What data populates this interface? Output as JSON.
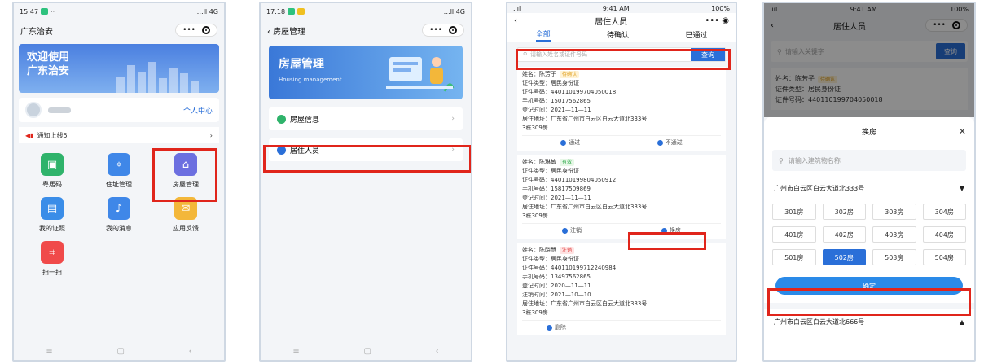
{
  "p1": {
    "time": "15:47",
    "dots": "··",
    "signal": ":::ll 4G",
    "title": "广东治安",
    "banner": [
      "欢迎使用",
      "广东治安"
    ],
    "user_link": "个人中心",
    "notice": "通知上线5",
    "grid": [
      {
        "label": "粤居码",
        "icon": "qr-card-icon",
        "color": "#2fb36b"
      },
      {
        "label": "住址管理",
        "icon": "location-icon",
        "color": "#3f87e8"
      },
      {
        "label": "房屋管理",
        "icon": "house-icon",
        "color": "#6c6fe0"
      },
      {
        "label": "我的证照",
        "icon": "id-card-icon",
        "color": "#3a8de8"
      },
      {
        "label": "我的消息",
        "icon": "bell-icon",
        "color": "#3f87e8"
      },
      {
        "label": "应用反馈",
        "icon": "mail-icon",
        "color": "#f3b73a"
      },
      {
        "label": "扫一扫",
        "icon": "scan-icon",
        "color": "#f04a4a"
      }
    ]
  },
  "p2": {
    "time": "17:18",
    "signal": ":::ll 4G",
    "title": "房屋管理",
    "banner_title": "房屋管理",
    "banner_sub": "Housing management",
    "menu": [
      {
        "label": "房屋信息",
        "color": "#2fb36b"
      },
      {
        "label": "居住人员",
        "color": "#2a6fd8"
      }
    ]
  },
  "p3": {
    "time": "9:41 AM",
    "battery": "100%",
    "title": "居住人员",
    "tabs": [
      "全部",
      "待确认",
      "已通过"
    ],
    "search_placeholder": "请输入姓名或证件号码",
    "search_btn": "查询",
    "cards": [
      {
        "name": "姓名：陈芳子",
        "tag": "待确认",
        "tagc": "y",
        "lines": [
          "证件类型：居民身份证",
          "证件号码：440110199704050018",
          "手机号码：15017562865",
          "登记时间：2021—11—11",
          "居住地址：广东省广州市白云区白云大道北333号",
          "3栋309房"
        ],
        "actions": [
          "通过",
          "不通过"
        ]
      },
      {
        "name": "姓名：陈琳敏",
        "tag": "有效",
        "tagc": "g",
        "lines": [
          "证件类型：居民身份证",
          "证件号码：440110199804050912",
          "手机号码：15817509869",
          "登记时间：2021—11—11",
          "居住地址：广东省广州市白云区白云大道北333号",
          "3栋309房"
        ],
        "actions": [
          "注销",
          "换房"
        ]
      },
      {
        "name": "姓名：陈晓慧",
        "tag": "注销",
        "tagc": "r",
        "lines": [
          "证件类型：居民身份证",
          "证件号码：440110199712240984",
          "手机号码：13497562865",
          "登记时间：2020—11—11",
          "注销时间：2021—10—10",
          "居住地址：广东省广州市白云区白云大道北333号",
          "3栋309房"
        ],
        "actions": [
          "删除"
        ]
      }
    ]
  },
  "p4": {
    "time": "9:41 AM",
    "battery": "100%",
    "title": "居住人员",
    "search_placeholder": "请输入关键字",
    "search_btn": "查询",
    "bg_name": "姓名：陈芳子",
    "bg_tag": "待确认",
    "bg_lines": [
      "证件类型：居民身份证",
      "证件号码：440110199704050018"
    ],
    "sheet_title": "换房",
    "building_placeholder": "请输入建筑物名称",
    "address1": "广州市白云区白云大道北333号",
    "rooms": [
      "301房",
      "302房",
      "303房",
      "304房",
      "401房",
      "402房",
      "403房",
      "404房",
      "501房",
      "502房",
      "503房",
      "504房"
    ],
    "selected_room": "502房",
    "confirm": "确定",
    "address2": "广州市白云区白云大道北666号"
  }
}
